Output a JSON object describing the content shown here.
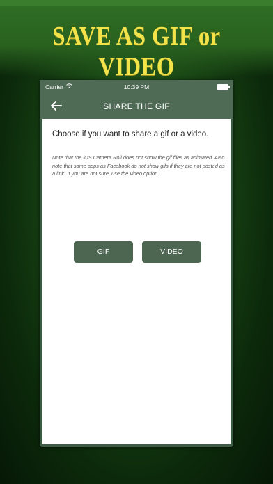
{
  "banner": {
    "title": "SAVE AS GIF or VIDEO"
  },
  "status_bar": {
    "carrier": "Carrier",
    "time": "10:39 PM"
  },
  "nav": {
    "title": "SHARE THE GIF"
  },
  "content": {
    "heading": "Choose if you want to share a gif or a video.",
    "note": "Note that the iOS Camera Roll does not show the gif files as animated. Also note that some apps as Facebook do not show gifs if they are not posted as a link. If you are not sure, use the video option."
  },
  "buttons": {
    "gif_label": "GIF",
    "video_label": "VIDEO"
  },
  "colors": {
    "banner_text": "#f3e34a",
    "nav_bg": "#4f6a55",
    "button_bg": "#4d6652"
  },
  "icons": {
    "back": "arrow-left-icon",
    "wifi": "wifi-icon",
    "battery": "battery-icon"
  }
}
